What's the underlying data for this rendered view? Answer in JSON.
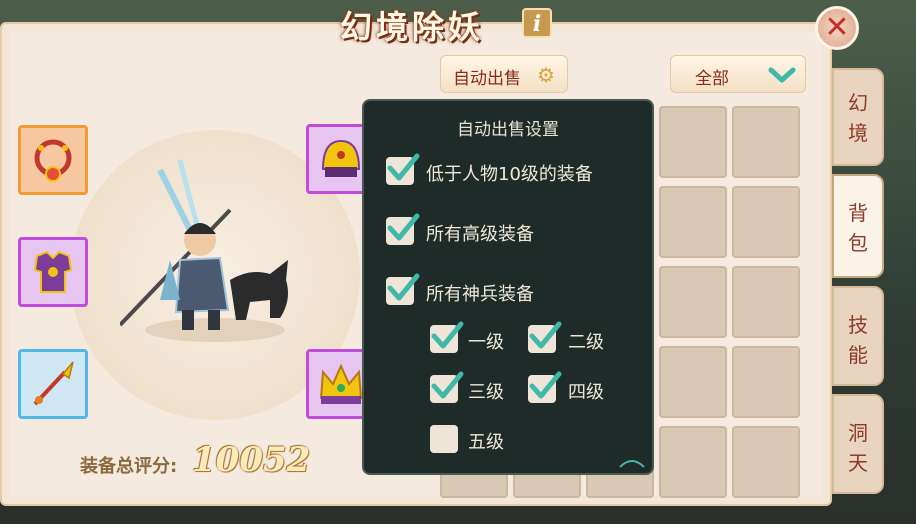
{
  "title": "幻境除妖",
  "info_glyph": "i",
  "close_glyph": "✕",
  "score": {
    "label": "装备总评分:",
    "value": "10052"
  },
  "toolbar": {
    "auto_sell_label": "自动出售",
    "filter_label": "全部"
  },
  "tabs": [
    {
      "label": "幻境",
      "active": false
    },
    {
      "label": "背包",
      "active": true
    },
    {
      "label": "技能",
      "active": false
    },
    {
      "label": "洞天",
      "active": false
    }
  ],
  "popup": {
    "title": "自动出售设置",
    "options": [
      {
        "label": "低于人物10级的装备",
        "checked": true
      },
      {
        "label": "所有高级装备",
        "checked": true
      },
      {
        "label": "所有神兵装备",
        "checked": true
      }
    ],
    "levels": [
      {
        "label": "一级",
        "checked": true
      },
      {
        "label": "二级",
        "checked": true
      },
      {
        "label": "三级",
        "checked": true
      },
      {
        "label": "四级",
        "checked": true
      },
      {
        "label": "五级",
        "checked": false
      }
    ]
  },
  "equipment_slots": [
    {
      "icon": "necklace-icon",
      "rarity": "orange"
    },
    {
      "icon": "armor-icon",
      "rarity": "purple"
    },
    {
      "icon": "spear-icon",
      "rarity": "blue"
    },
    {
      "icon": "helmet-icon",
      "rarity": "purple"
    },
    {
      "icon": "crown-icon",
      "rarity": "purple"
    }
  ],
  "colors": {
    "accent": "#8c2a1a",
    "check": "#3fb8a8",
    "popup_bg": "#1f2b29"
  }
}
